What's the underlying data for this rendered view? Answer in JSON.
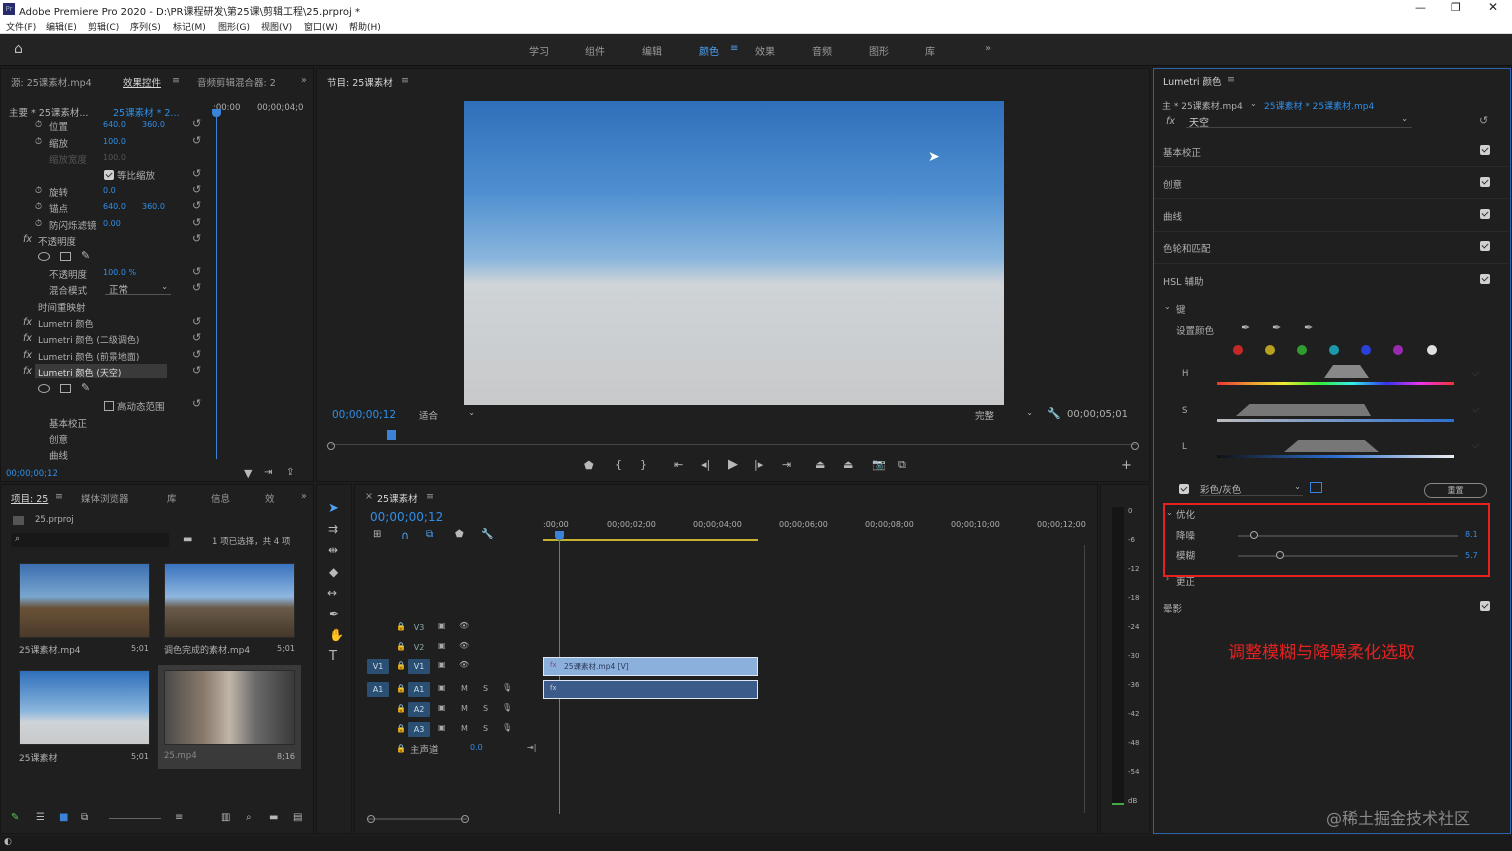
{
  "window": {
    "title": "Adobe Premiere Pro 2020 - D:\\PR课程研发\\第25课\\剪辑工程\\25.prproj *"
  },
  "menu": [
    "文件(F)",
    "编辑(E)",
    "剪辑(C)",
    "序列(S)",
    "标记(M)",
    "图形(G)",
    "视图(V)",
    "窗口(W)",
    "帮助(H)"
  ],
  "workspaces": [
    "学习",
    "组件",
    "编辑",
    "颜色",
    "效果",
    "音频",
    "图形",
    "库"
  ],
  "effect_panel": {
    "tabs": [
      "源: 25课素材.mp4",
      "效果控件",
      "音频剪辑混合器: 2"
    ],
    "master_label": "主要 * 25课素材...",
    "clip_label": "25课素材 * 2...",
    "ruler_start": ":00:00",
    "ruler_end": "00;00;04;0",
    "rows": [
      {
        "label": "位置",
        "v1": "640.0",
        "v2": "360.0"
      },
      {
        "label": "缩放",
        "v1": "100.0",
        "v2": ""
      },
      {
        "label": "缩放宽度",
        "v1": "100.0",
        "v2": ""
      },
      {
        "label": "等比缩放",
        "v1": "",
        "v2": ""
      },
      {
        "label": "旋转",
        "v1": "0.0",
        "v2": ""
      },
      {
        "label": "锚点",
        "v1": "640.0",
        "v2": "360.0"
      },
      {
        "label": "防闪烁滤镜",
        "v1": "0.00",
        "v2": ""
      }
    ],
    "opacity_header": "不透明度",
    "opacity_label": "不透明度",
    "opacity_value": "100.0 %",
    "blend_label": "混合模式",
    "blend_value": "正常",
    "time_remap": "时间重映射",
    "lumetri_list": [
      "Lumetri 颜色",
      "Lumetri 颜色 (二级调色)",
      "Lumetri 颜色 (前景地面)",
      "Lumetri 颜色 (天空)"
    ],
    "hdr_label": "高动态范围",
    "sub_items": [
      "基本校正",
      "创意",
      "曲线"
    ],
    "timecode": "00;00;00;12"
  },
  "program": {
    "tab": "节目: 25课素材",
    "timecode": "00;00;00;12",
    "fit": "适合",
    "quality": "完整",
    "duration": "00;00;05;01"
  },
  "project": {
    "tabs": [
      "项目: 25",
      "媒体浏览器",
      "库",
      "信息",
      "效"
    ],
    "file": "25.prproj",
    "selection": "1 项已选择，共 4 项",
    "items": [
      {
        "name": "25课素材.mp4",
        "dur": "5;01"
      },
      {
        "name": "调色完成的素材.mp4",
        "dur": "5;01"
      },
      {
        "name": "25课素材",
        "dur": "5;01"
      },
      {
        "name": "25.mp4",
        "dur": "8;16"
      }
    ]
  },
  "timeline": {
    "tab": "25课素材",
    "timecode": "00;00;00;12",
    "ruler": [
      ":00;00",
      "00;00;02;00",
      "00;00;04;00",
      "00;00;06;00",
      "00;00;08;00",
      "00;00;10;00",
      "00;00;12;00"
    ],
    "tracks": [
      "V3",
      "V2",
      "V1",
      "A1",
      "A2",
      "A3"
    ],
    "master": "主声道",
    "master_val": "0.0",
    "clip_label": "25课素材.mp4 [V]"
  },
  "meter": [
    "0",
    "-6",
    "-12",
    "-18",
    "-24",
    "-30",
    "-36",
    "-42",
    "-48",
    "-54",
    "dB"
  ],
  "lumetri": {
    "tab": "Lumetri 颜色",
    "master": "主 * 25课素材.mp4",
    "clip": "25课素材 * 25课素材.mp4",
    "preset": "天空",
    "sections": [
      "基本校正",
      "创意",
      "曲线",
      "色轮和匹配",
      "HSL 辅助"
    ],
    "key_label": "键",
    "set_color": "设置颜色",
    "hsl": [
      "H",
      "S",
      "L"
    ],
    "color_gray": "彩色/灰色",
    "reset": "重置",
    "refine": "优化",
    "denoise_label": "降噪",
    "denoise_value": "8.1",
    "blur_label": "模糊",
    "blur_value": "5.7",
    "correction": "更正",
    "vignette": "晕影",
    "swatches": [
      "#c62828",
      "#b8a020",
      "#2e9c2e",
      "#1a9aa8",
      "#2a40d8",
      "#9a2ab0",
      "#e0e0e0"
    ],
    "annotation": "调整模糊与降噪柔化选取",
    "watermark": "@稀土掘金技术社区"
  }
}
